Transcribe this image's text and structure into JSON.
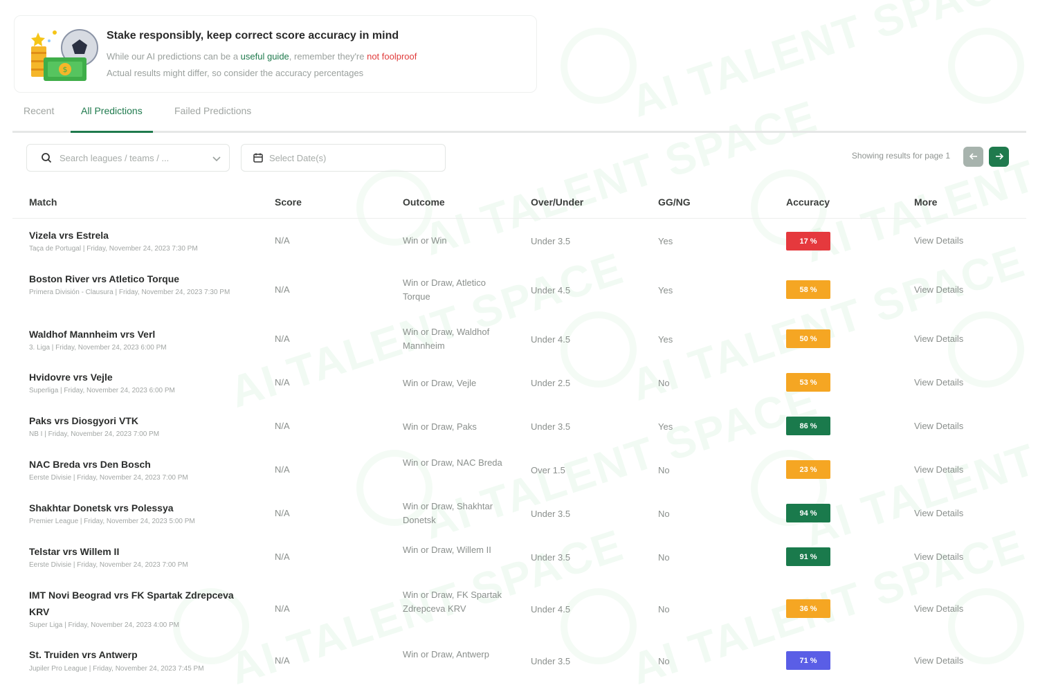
{
  "banner": {
    "title": "Stake responsibly, keep correct score accuracy in mind",
    "line1_a": "While our AI predictions can be a ",
    "line1_guide": "useful guide",
    "line1_b": ", remember they're ",
    "line1_notfool": "not foolproof",
    "line2": "Actual results might differ, so consider the accuracy percentages"
  },
  "tabs": [
    {
      "label": "Recent",
      "active": false
    },
    {
      "label": "All Predictions",
      "active": true
    },
    {
      "label": "Failed Predictions",
      "active": false
    }
  ],
  "search": {
    "placeholder": "Search leagues / teams / ..."
  },
  "date": {
    "placeholder": "Select Date(s)"
  },
  "paging": {
    "text": "Showing results for page 1",
    "prev_icon": "arrow-left-icon",
    "next_icon": "arrow-right-icon"
  },
  "table": {
    "headers": {
      "match": "Match",
      "score": "Score",
      "outcome": "Outcome",
      "over_under": "Over/Under",
      "ggng": "GG/NG",
      "accuracy": "Accuracy",
      "more": "More"
    },
    "rows": [
      {
        "match": "Vizela vrs Estrela",
        "meta": "Taça de Portugal | Friday, November 24, 2023 7:30 PM",
        "score": "N/A",
        "outcome": "Win or Win",
        "over_under": "Under 3.5",
        "ggng": "Yes",
        "accuracy": "17 %",
        "accuracy_color": "#e5393d",
        "more": "View Details"
      },
      {
        "match": "Boston River vrs Atletico Torque",
        "meta": "Primera División - Clausura | Friday, November 24, 2023 7:30 PM",
        "score": "N/A",
        "outcome": "Win or Draw, Atletico Torque",
        "over_under": "Under 4.5",
        "ggng": "Yes",
        "accuracy": "58 %",
        "accuracy_color": "#f5a623",
        "more": "View Details"
      },
      {
        "match": "Waldhof Mannheim vrs Verl",
        "meta": "3. Liga | Friday, November 24, 2023 6:00 PM",
        "score": "N/A",
        "outcome": "Win or Draw, Waldhof Mannheim",
        "over_under": "Under 4.5",
        "ggng": "Yes",
        "accuracy": "50 %",
        "accuracy_color": "#f5a623",
        "more": "View Details"
      },
      {
        "match": "Hvidovre vrs Vejle",
        "meta": "Superliga | Friday, November 24, 2023 6:00 PM",
        "score": "N/A",
        "outcome": "Win or Draw, Vejle",
        "over_under": "Under 2.5",
        "ggng": "No",
        "accuracy": "53 %",
        "accuracy_color": "#f5a623",
        "more": "View Details"
      },
      {
        "match": "Paks vrs Diosgyori VTK",
        "meta": "NB I | Friday, November 24, 2023 7:00 PM",
        "score": "N/A",
        "outcome": "Win or Draw, Paks",
        "over_under": "Under 3.5",
        "ggng": "Yes",
        "accuracy": "86 %",
        "accuracy_color": "#1a7a4c",
        "more": "View Details"
      },
      {
        "match": "NAC Breda vrs Den Bosch",
        "meta": "Eerste Divisie | Friday, November 24, 2023 7:00 PM",
        "score": "N/A",
        "outcome": "Win or Draw, NAC Breda",
        "over_under": "Over 1.5",
        "ggng": "No",
        "accuracy": "23 %",
        "accuracy_color": "#f5a623",
        "more": "View Details"
      },
      {
        "match": "Shakhtar Donetsk vrs Polessya",
        "meta": "Premier League | Friday, November 24, 2023 5:00 PM",
        "score": "N/A",
        "outcome": "Win or Draw, Shakhtar Donetsk",
        "over_under": "Under 3.5",
        "ggng": "No",
        "accuracy": "94 %",
        "accuracy_color": "#1a7a4c",
        "more": "View Details"
      },
      {
        "match": "Telstar vrs Willem II",
        "meta": "Eerste Divisie | Friday, November 24, 2023 7:00 PM",
        "score": "N/A",
        "outcome": "Win or Draw, Willem II",
        "over_under": "Under 3.5",
        "ggng": "No",
        "accuracy": "91 %",
        "accuracy_color": "#1a7a4c",
        "more": "View Details"
      },
      {
        "match": "IMT Novi Beograd vrs FK Spartak Zdrepceva KRV",
        "meta": "Super Liga | Friday, November 24, 2023 4:00 PM",
        "score": "N/A",
        "outcome": "Win or Draw, FK Spartak Zdrepceva KRV",
        "over_under": "Under 4.5",
        "ggng": "No",
        "accuracy": "36 %",
        "accuracy_color": "#f5a623",
        "more": "View Details"
      },
      {
        "match": "St. Truiden vrs Antwerp",
        "meta": "Jupiler Pro League | Friday, November 24, 2023 7:45 PM",
        "score": "N/A",
        "outcome": "Win or Draw, Antwerp",
        "over_under": "Under 3.5",
        "ggng": "No",
        "accuracy": "71 %",
        "accuracy_color": "#5a5ee6",
        "more": "View Details"
      }
    ]
  },
  "watermark": "AI TALENT SPACE",
  "colors": {
    "brand": "#1f7a4d",
    "danger": "#e03b3b"
  }
}
